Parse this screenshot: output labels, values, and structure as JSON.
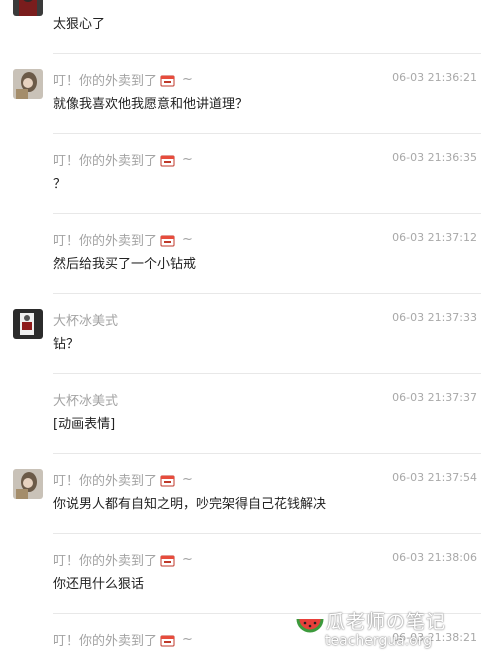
{
  "messages": [
    {
      "id": "m0",
      "sender": "",
      "time": "",
      "text": "太狠心了",
      "avatar": "girl",
      "has_emoji": false
    },
    {
      "id": "m1",
      "sender": "叮！你的外卖到了",
      "time": "06-03 21:36:21",
      "text": "就像我喜欢他我愿意和他讲道理？",
      "avatar": "girl",
      "has_emoji": true
    },
    {
      "id": "m2",
      "sender": "叮！你的外卖到了",
      "time": "06-03 21:36:35",
      "text": "？",
      "avatar": "",
      "has_emoji": true
    },
    {
      "id": "m3",
      "sender": "叮！你的外卖到了",
      "time": "06-03 21:37:12",
      "text": "然后给我买了一个小钻戒",
      "avatar": "",
      "has_emoji": true
    },
    {
      "id": "m4",
      "sender": "大杯冰美式",
      "time": "06-03 21:37:33",
      "text": "钻？",
      "avatar": "dark",
      "has_emoji": false
    },
    {
      "id": "m5",
      "sender": "大杯冰美式",
      "time": "06-03 21:37:37",
      "text": "[动画表情]",
      "avatar": "",
      "has_emoji": false
    },
    {
      "id": "m6",
      "sender": "叮！你的外卖到了",
      "time": "06-03 21:37:54",
      "text": "你说男人都有自知之明，吵完架得自己花钱解决",
      "avatar": "girl",
      "has_emoji": true
    },
    {
      "id": "m7",
      "sender": "叮！你的外卖到了",
      "time": "06-03 21:38:06",
      "text": "你还甩什么狠话",
      "avatar": "",
      "has_emoji": true
    },
    {
      "id": "m8",
      "sender": "叮！你的外卖到了",
      "time": "06-03 21:38:21",
      "text": "",
      "avatar": "",
      "has_emoji": true
    }
  ],
  "sender_suffix": "~",
  "watermark": {
    "title": "瓜老师の笔记",
    "url": "teachergua.org"
  }
}
